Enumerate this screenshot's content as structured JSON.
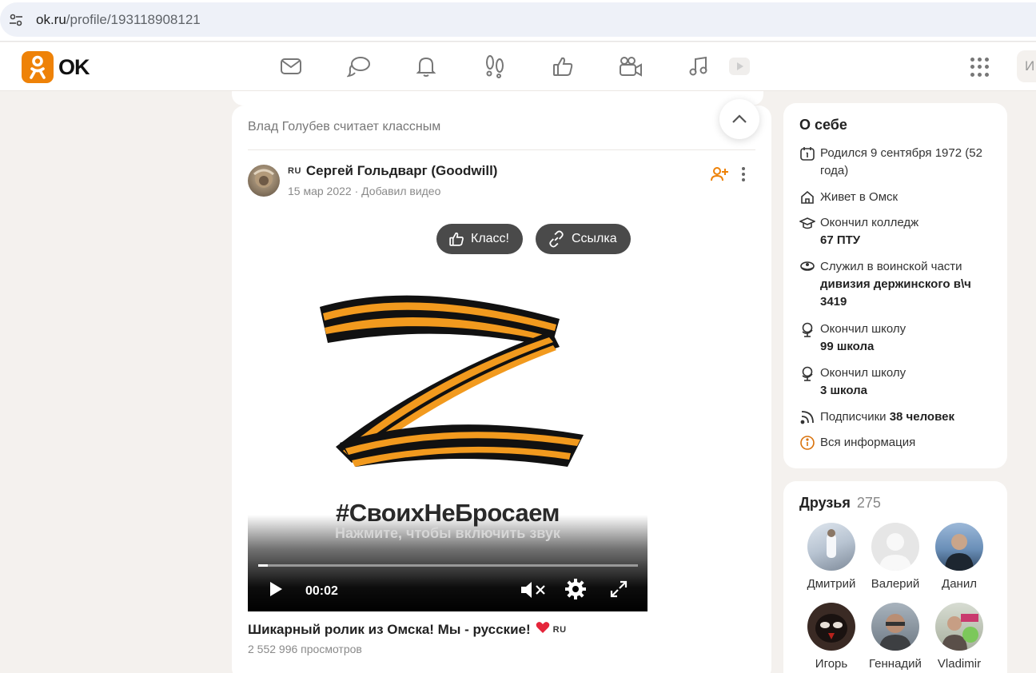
{
  "browser": {
    "url_host": "ok.ru",
    "url_path": "/profile/193118908121"
  },
  "header": {
    "logo_text": "OK",
    "nav_icons": [
      "mail-icon",
      "chat-icon",
      "bell-icon",
      "guests-icon",
      "like-icon",
      "video-camera-icon",
      "music-icon",
      "video-play-icon"
    ],
    "search_stub": "И"
  },
  "post": {
    "context": "Влад Голубев считает классным",
    "author_badge": "RU",
    "author": "Сергей Гольдварг (Goodwill)",
    "date": "15 мар 2022",
    "action": "Добавил видео",
    "buttons": {
      "klass": "Класс!",
      "link": "Ссылка"
    },
    "video": {
      "hashtag": "#СвоихНеБросаем",
      "sound_hint": "Нажмите, чтобы включить звук",
      "time": "00:02",
      "progress_fraction": 0.025
    },
    "title": "Шикарный ролик из Омска! Мы - русские!",
    "title_badge": "RU",
    "views": "2 552 996 просмотров"
  },
  "about": {
    "title": "О себе",
    "born": "Родился 9 сентября 1972 (52 года)",
    "lives": "Живет в Омск",
    "college_label": "Окончил колледж",
    "college_value": "67 ПТУ",
    "military_label": "Служил в воинской части",
    "military_value": "дивизия держинского в\\ч 3419",
    "school1_label": "Окончил школу",
    "school1_value": "99 школа",
    "school2_label": "Окончил школу",
    "school2_value": "3 школа",
    "subscribers_label": "Подписчики",
    "subscribers_value": "38 человек",
    "all_info": "Вся информация"
  },
  "friends": {
    "title": "Друзья",
    "count": "275",
    "list": [
      {
        "name": "Дмитрий"
      },
      {
        "name": "Валерий"
      },
      {
        "name": "Данил"
      },
      {
        "name": "Игорь"
      },
      {
        "name": "Геннадий"
      },
      {
        "name": "Vladimir"
      }
    ]
  },
  "colors": {
    "brand_orange": "#ee8208",
    "link_orange": "#d9730d",
    "page_bg": "#f4f1ee"
  }
}
